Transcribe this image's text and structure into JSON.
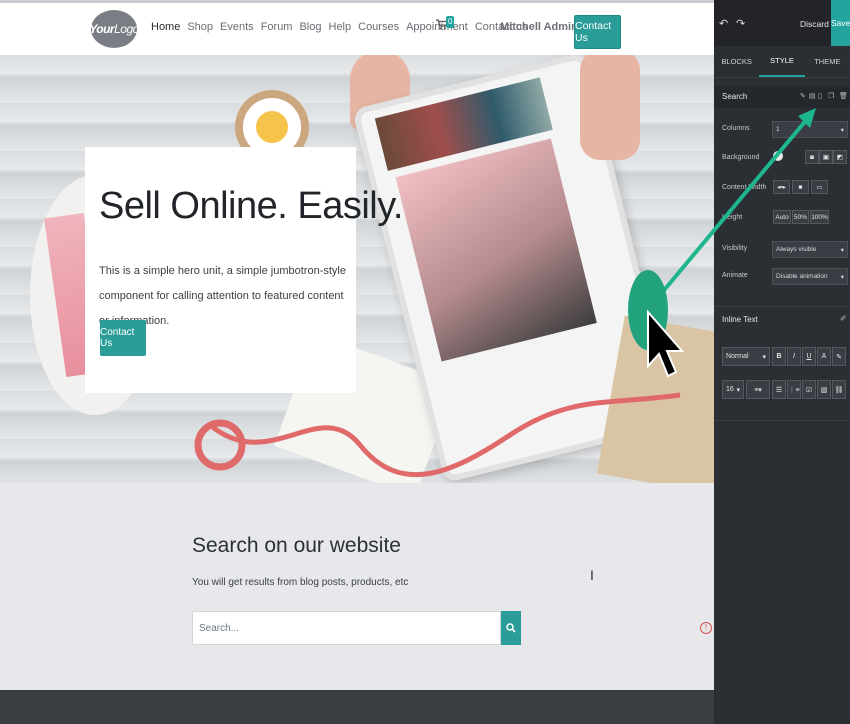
{
  "navbar": {
    "logo_text_bold": "Your",
    "logo_text_thin": "Logo",
    "menu": [
      "Home",
      "Shop",
      "Events",
      "Forum",
      "Blog",
      "Help",
      "Courses",
      "Appointment",
      "Contact us"
    ],
    "cart_count": "0",
    "user_name": "Mitchell Admin",
    "contact_button": "Contact Us"
  },
  "hero": {
    "title": "Sell Online. Easily.",
    "text": "This is a simple hero unit, a simple jumbotron-style component for calling attention to featured content or information.",
    "button": "Contact Us"
  },
  "search_section": {
    "title": "Search on our website",
    "subtitle": "You will get results from blog posts, products, etc",
    "placeholder": "Search..."
  },
  "editor": {
    "discard": "Discard",
    "save": "Save",
    "tabs": [
      "BLOCKS",
      "STYLE",
      "THEME"
    ],
    "active_tab": "STYLE",
    "snippet_name": "Search",
    "options": {
      "columns_label": "Columns",
      "columns_value": "1",
      "background_label": "Background",
      "content_width_label": "Content Width",
      "height_label": "Height",
      "height_options": [
        "Auto",
        "50%",
        "100%"
      ],
      "visibility_label": "Visibility",
      "visibility_value": "Always visible",
      "animate_label": "Animate",
      "animate_value": "Disable animation"
    },
    "inline_text": {
      "label": "Inline Text",
      "style_value": "Normal",
      "font_size": "16",
      "format_buttons": [
        "B",
        "I",
        "U",
        "A"
      ]
    }
  },
  "colors": {
    "accent": "#2a9d98",
    "editor_bg": "#2b2e33",
    "editor_top": "#222428",
    "page_bg": "#e7e8eb",
    "pointer_bubble": "#22a37e"
  }
}
